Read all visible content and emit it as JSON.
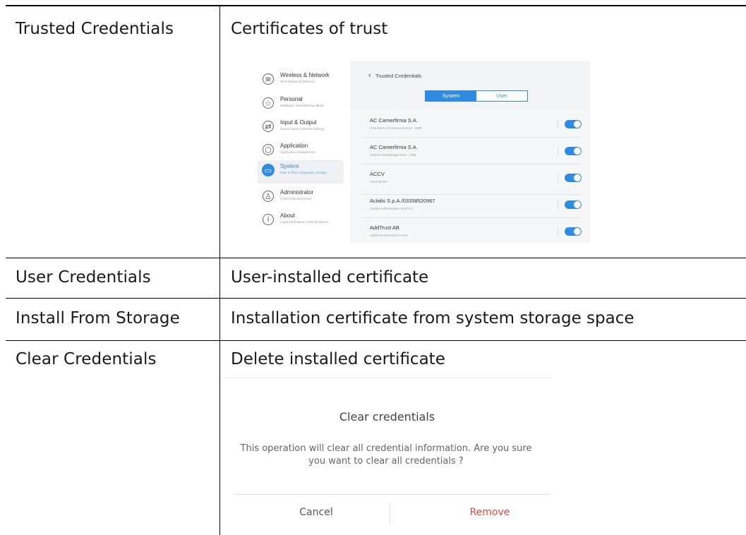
{
  "rows": [
    {
      "term": "Trusted Credentials",
      "description": "Certificates of trust"
    },
    {
      "term": "User Credentials",
      "description": "User-installed certificate"
    },
    {
      "term": "Install From Storage",
      "description": "Installation certificate from system storage space"
    },
    {
      "term": "Clear Credentials",
      "description": "Delete installed certificate"
    }
  ],
  "settings_screenshot": {
    "sidebar": [
      {
        "title": "Wireless & Network",
        "subtitle": "Wi-Fi Bluetooth Ethernet",
        "icon": "wifi-icon",
        "glyph": "≋"
      },
      {
        "title": "Personal",
        "subtitle": "Wallpaper, Multi-Window Mode",
        "icon": "star-icon",
        "glyph": "☆"
      },
      {
        "title": "Input & Output",
        "subtitle": "Sound output, Channel settings",
        "icon": "swap-arrows-icon",
        "glyph": "⇄"
      },
      {
        "title": "Application",
        "subtitle": "Application management",
        "icon": "hexagon-icon",
        "glyph": "⬡"
      },
      {
        "title": "System",
        "subtitle": "Date & Time, Language, Storage",
        "icon": "monitor-icon",
        "glyph": "▭",
        "active": true
      },
      {
        "title": "Administrator",
        "subtitle": "Control,Security,Clone",
        "icon": "person-icon",
        "glyph": "♙"
      },
      {
        "title": "About",
        "subtitle": "Legal information, Android version",
        "icon": "info-icon",
        "glyph": "i"
      }
    ],
    "panel": {
      "back_glyph": "‹",
      "title": "Trusted Credentials",
      "segments": [
        "System",
        "User"
      ],
      "selected_segment": "System",
      "certificates": [
        {
          "name": "AC Camerfirma S.A.",
          "detail": "Chambers of Commerce Root - 2008",
          "enabled": true
        },
        {
          "name": "AC Camerfirma S.A.",
          "detail": "Global Chambersign Root - 2008",
          "enabled": true
        },
        {
          "name": "ACCV",
          "detail": "ACCVRAIZ1",
          "enabled": true
        },
        {
          "name": "Actalis S.p.A./03358520967",
          "detail": "Actalis Authentication Root CA",
          "enabled": true
        },
        {
          "name": "AddTrust AB",
          "detail": "AddTrust External CA Root",
          "enabled": true
        }
      ]
    },
    "accent_color": "#2e8be0"
  },
  "dialog": {
    "title": "Clear credentials",
    "message": "This operation will clear all credential information. Are you sure you want to clear all credentials ?",
    "cancel_label": "Cancel",
    "remove_label": "Remove",
    "remove_color": "#e14a44"
  }
}
